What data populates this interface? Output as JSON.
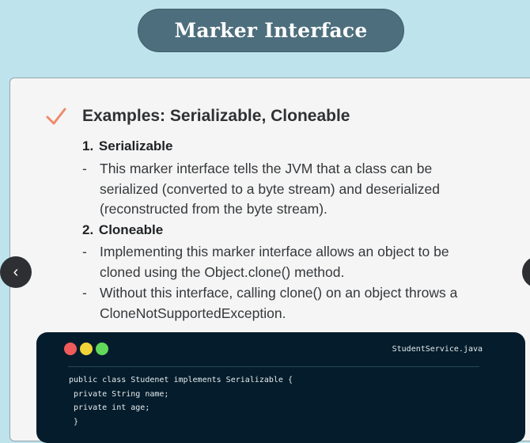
{
  "title": "Marker Interface",
  "section": {
    "heading": "Examples: Serializable, Cloneable",
    "items": [
      {
        "number": "1.",
        "name": "Serializable",
        "bullets": [
          {
            "dash": "-",
            "text": "This marker interface tells the JVM that a class can be serialized (converted to a byte stream) and deserialized (reconstructed from the byte stream)."
          }
        ]
      },
      {
        "number": "2.",
        "name": "Cloneable",
        "bullets": [
          {
            "dash": "-",
            "text": "Implementing this marker interface allows an object to be cloned using the Object.clone() method."
          },
          {
            "dash": "-",
            "text": "Without this interface, calling clone() on an object throws a CloneNotSupportedException."
          }
        ]
      }
    ]
  },
  "code": {
    "filename": "StudentService.java",
    "lines": [
      "public class Studenet implements Serializable {",
      " private String name;",
      " private int age;",
      " }"
    ]
  },
  "nav": {
    "prev_icon": "‹",
    "next_icon": "›"
  },
  "colors": {
    "background": "#bfe3ec",
    "title_pill": "#4d6e7d",
    "checkmark": "#f08a6a",
    "code_bg": "#041c2b",
    "dot_red": "#ef5a5a",
    "dot_yellow": "#f2d338",
    "dot_green": "#62d95a"
  }
}
